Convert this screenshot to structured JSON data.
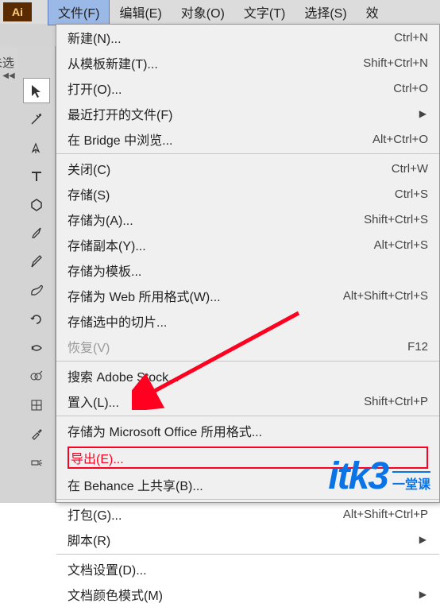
{
  "app_icon": "Ai",
  "menubar": {
    "file": "文件(F)",
    "edit": "编辑(E)",
    "object": "对象(O)",
    "type": "文字(T)",
    "select": "选择(S)",
    "effect": "效"
  },
  "unselected": "未选",
  "dropdown": {
    "new": {
      "label": "新建(N)...",
      "shortcut": "Ctrl+N"
    },
    "new_template": {
      "label": "从模板新建(T)...",
      "shortcut": "Shift+Ctrl+N"
    },
    "open": {
      "label": "打开(O)...",
      "shortcut": "Ctrl+O"
    },
    "recent": {
      "label": "最近打开的文件(F)",
      "submenu": true
    },
    "bridge": {
      "label": "在 Bridge 中浏览...",
      "shortcut": "Alt+Ctrl+O"
    },
    "close": {
      "label": "关闭(C)",
      "shortcut": "Ctrl+W"
    },
    "save": {
      "label": "存储(S)",
      "shortcut": "Ctrl+S"
    },
    "save_as": {
      "label": "存储为(A)...",
      "shortcut": "Shift+Ctrl+S"
    },
    "save_copy": {
      "label": "存储副本(Y)...",
      "shortcut": "Alt+Ctrl+S"
    },
    "save_template": {
      "label": "存储为模板..."
    },
    "save_web": {
      "label": "存储为 Web 所用格式(W)...",
      "shortcut": "Alt+Shift+Ctrl+S"
    },
    "save_slices": {
      "label": "存储选中的切片..."
    },
    "revert": {
      "label": "恢复(V)",
      "shortcut": "F12"
    },
    "stock": {
      "label": "搜索 Adobe Stock..."
    },
    "place": {
      "label": "置入(L)...",
      "shortcut": "Shift+Ctrl+P"
    },
    "msoffice": {
      "label": "存储为 Microsoft Office 所用格式..."
    },
    "export": {
      "label": "导出(E)..."
    },
    "behance": {
      "label": "在 Behance 上共享(B)..."
    },
    "package": {
      "label": "打包(G)...",
      "shortcut": "Alt+Shift+Ctrl+P"
    },
    "scripts": {
      "label": "脚本(R)",
      "submenu": true
    },
    "docsetup": {
      "label": "文档设置(D)..."
    },
    "colormode": {
      "label": "文档颜色模式(M)",
      "submenu": true
    }
  },
  "watermark": {
    "main": "itk3",
    "sub": "一堂课"
  }
}
